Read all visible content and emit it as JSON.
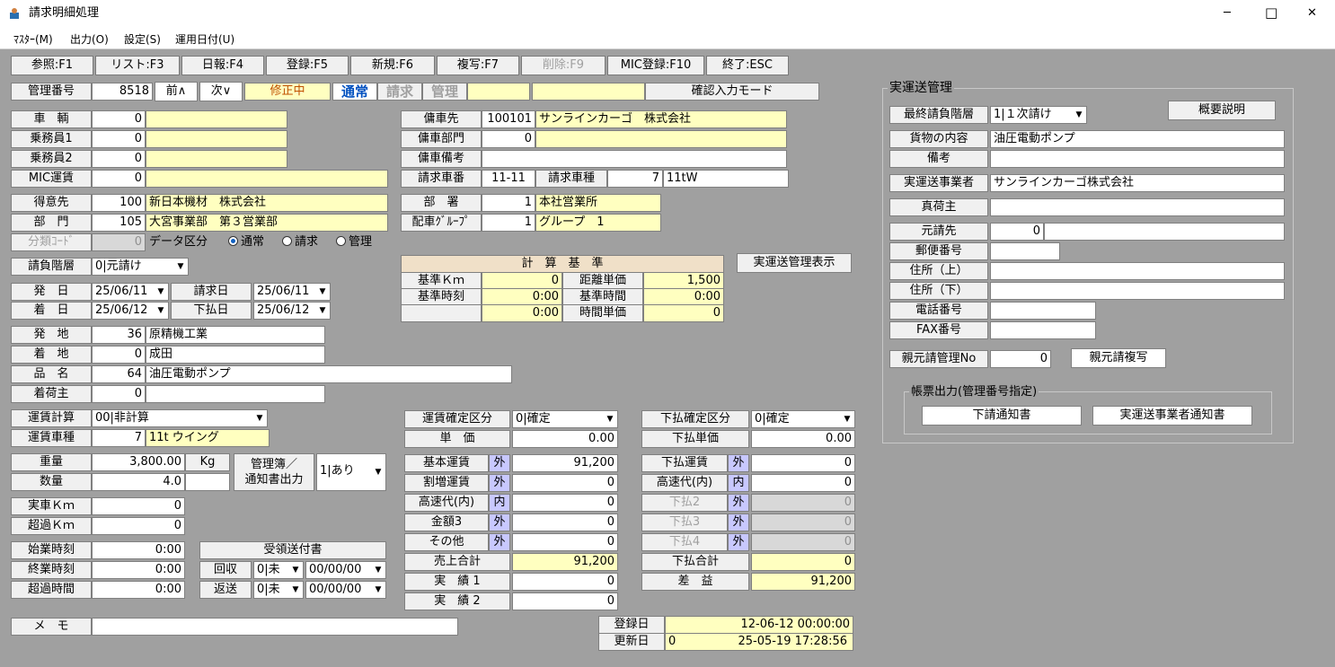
{
  "window": {
    "title": "請求明細処理",
    "min": "─",
    "max": "□",
    "close": "✕"
  },
  "menu": [
    "ﾏｽﾀｰ(M)",
    "出力(O)",
    "設定(S)",
    "運用日付(U)"
  ],
  "fkeys": [
    "参照:F1",
    "リスト:F3",
    "日報:F4",
    "登録:F5",
    "新規:F6",
    "複写:F7",
    "削除:F9",
    "MIC登録:F10",
    "終了:ESC"
  ],
  "header": {
    "kanri_label": "管理番号",
    "kanri_no": "8518",
    "prev": "前∧",
    "next": "次∨",
    "status": "修正中",
    "mode_tsujo": "通常",
    "mode_seikyu": "請求",
    "mode_kanri": "管理",
    "confirm_mode": "確認入力モード"
  },
  "vehicle": {
    "rows": [
      {
        "label": "車　輌",
        "val": "0"
      },
      {
        "label": "乗務員1",
        "val": "0"
      },
      {
        "label": "乗務員2",
        "val": "0"
      },
      {
        "label": "MIC運賃",
        "val": "0"
      }
    ]
  },
  "customer": {
    "tokui_label": "得意先",
    "tokui_code": "100",
    "tokui_name": "新日本機材　株式会社",
    "bumon_label": "部　門",
    "bumon_code": "105",
    "bumon_name": "大宮事業部　第３営業部",
    "bunrui_label": "分類ｺｰﾄﾞ",
    "bunrui_code": "0",
    "data_kubun_label": "データ区分",
    "radio": [
      "通常",
      "請求",
      "管理"
    ]
  },
  "charter": {
    "yosha_label": "傭車先",
    "yosha_code": "100101",
    "yosha_name": "サンラインカーゴ　株式会社",
    "yosha_bumon_label": "傭車部門",
    "yosha_bumon_code": "0",
    "yosha_biko_label": "傭車備考",
    "seikyu_shaban_label": "請求車番",
    "seikyu_shaban": "11-11",
    "seikyu_shashu_label": "請求車種",
    "seikyu_shashu_code": "7",
    "seikyu_shashu_name": "11tW"
  },
  "busho": {
    "busho_label": "部　署",
    "busho_code": "1",
    "busho_name": "本社営業所",
    "haisha_label": "配車ｸﾞﾙｰﾌﾟ",
    "haisha_code": "1",
    "haisha_name": "グループ　1"
  },
  "ukeoi": {
    "label": "請負階層",
    "value": "0|元請け"
  },
  "dates": {
    "hatsu_label": "発　日",
    "hatsu": "25/06/11",
    "seikyu_label": "請求日",
    "seikyu": "25/06/11",
    "chaku_label": "着　日",
    "chaku": "25/06/12",
    "shiharai_label": "下払日",
    "shiharai": "25/06/12"
  },
  "calc": {
    "title": "計　算　基　準",
    "kijun_km_label": "基準Ｋｍ",
    "kijun_km": "0",
    "kyori_tanka_label": "距離単価",
    "kyori_tanka": "1,500",
    "kijun_jikoku_label": "基準時刻",
    "kijun_jikoku": "0:00",
    "kijun_jikan_label": "基準時間",
    "kijun_jikan": "0:00",
    "row3_val": "0:00",
    "jikan_tanka_label": "時間単価",
    "jikan_tanka": "0"
  },
  "jitsu_btn": "実運送管理表示",
  "route": {
    "hatchi_label": "発　地",
    "hatchi_code": "36",
    "hatchi_name": "原精機工業",
    "chakuchi_label": "着　地",
    "chakuchi_code": "0",
    "chakuchi_name": "成田",
    "hinmei_label": "品　名",
    "hinmei_code": "64",
    "hinmei_name": "油圧電動ポンプ",
    "chakuninushi_label": "着荷主",
    "chakuninushi_code": "0"
  },
  "fare": {
    "keisan_label": "運賃計算",
    "keisan": "00|非計算",
    "shashu_label": "運賃車種",
    "shashu_code": "7",
    "shashu_name": "11t ウイング"
  },
  "weight": {
    "juryo_label": "重量",
    "juryo": "3,800.00",
    "unit": "Kg",
    "suryo_label": "数量",
    "suryo": "4.0",
    "kanribo_label1": "管理簿／",
    "kanribo_label2": "通知書出力",
    "kanribo": "1|あり"
  },
  "km": {
    "jissha_label": "実車Ｋｍ",
    "jissha": "0",
    "choka_label": "超過Ｋｍ",
    "choka": "0"
  },
  "time": {
    "shigyo_label": "始業時刻",
    "shigyo": "0:00",
    "shugyo_label": "終業時刻",
    "shugyo": "0:00",
    "choka_label": "超過時間",
    "choka": "0:00"
  },
  "receipt": {
    "title": "受領送付書",
    "kaishu_label": "回収",
    "kaishu": "0|未",
    "kaishu_date": "00/00/00",
    "henso_label": "返送",
    "henso": "0|未",
    "henso_date": "00/00/00"
  },
  "sales": {
    "kakutei_label": "運賃確定区分",
    "kakutei": "0|確定",
    "tanka_label": "単　価",
    "tanka": "0.00",
    "rows": [
      {
        "label": "基本運賃",
        "tag": "外",
        "val": "91,200"
      },
      {
        "label": "割増運賃",
        "tag": "外",
        "val": "0"
      },
      {
        "label": "高速代(内)",
        "tag": "内",
        "val": "0"
      },
      {
        "label": "金額3",
        "tag": "外",
        "val": "0"
      },
      {
        "label": "その他",
        "tag": "外",
        "val": "0"
      }
    ],
    "total_label": "売上合計",
    "total": "91,200",
    "jisseki1_label": "実　績 1",
    "jisseki1": "0",
    "jisseki2_label": "実　績 2",
    "jisseki2": "0"
  },
  "payment": {
    "kakutei_label": "下払確定区分",
    "kakutei": "0|確定",
    "tanka_label": "下払単価",
    "tanka": "0.00",
    "rows": [
      {
        "label": "下払運賃",
        "tag": "外",
        "val": "0"
      },
      {
        "label": "高速代(内)",
        "tag": "内",
        "val": "0"
      },
      {
        "label": "下払2",
        "tag": "外",
        "val": "0"
      },
      {
        "label": "下払3",
        "tag": "外",
        "val": "0"
      },
      {
        "label": "下払4",
        "tag": "外",
        "val": "0"
      }
    ],
    "total_label": "下払合計",
    "total": "0",
    "sa_label": "差　益",
    "sa": "91,200"
  },
  "memo": {
    "label": "メ　モ",
    "value": ""
  },
  "reg": {
    "toroku_label": "登録日",
    "toroku": "12-06-12 00:00:00",
    "koshin_label": "更新日",
    "koshin_code": "0",
    "koshin": "25-05-19 17:28:56"
  },
  "right": {
    "title": "実運送管理",
    "saishu_label": "最終請負階層",
    "saishu": "1|１次請け",
    "gaiyo_btn": "概要説明",
    "kamotsu_label": "貨物の内容",
    "kamotsu": "油圧電動ポンプ",
    "biko_label": "備考",
    "jigyosha_label": "実運送事業者",
    "jigyosha": "サンラインカーゴ株式会社",
    "shin_ninushi_label": "真荷主",
    "motouke_label": "元請先",
    "motouke_code": "0",
    "yubin_label": "郵便番号",
    "addr1_label": "住所（上）",
    "addr2_label": "住所（下）",
    "tel_label": "電話番号",
    "fax_label": "FAX番号",
    "oya_label": "親元請管理No",
    "oya": "0",
    "oya_copy_btn": "親元請複写",
    "chohyo_title": "帳票出力(管理番号指定)",
    "shita_btn": "下請通知書",
    "jigyosha_btn": "実運送事業者通知書"
  }
}
